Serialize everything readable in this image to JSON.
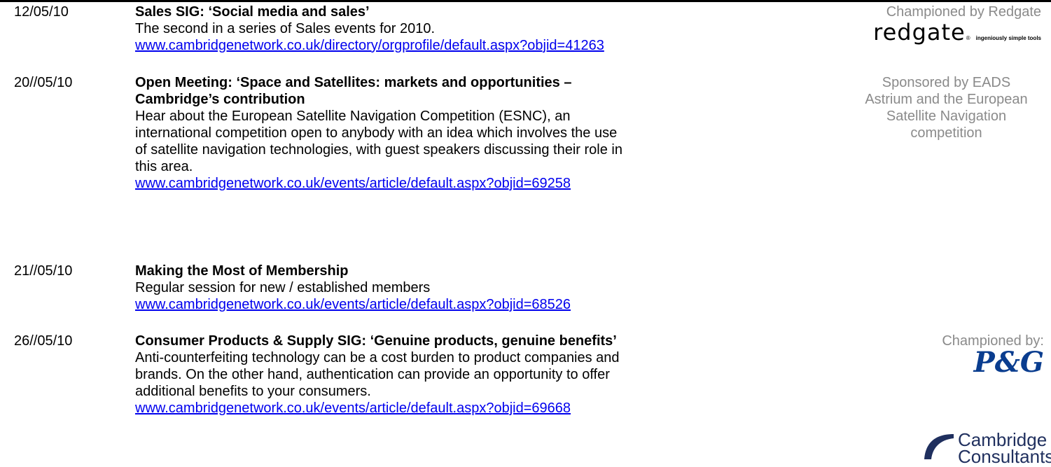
{
  "events": [
    {
      "date": "12/05/10",
      "title": "Sales SIG: ‘Social media and sales’",
      "description": "The second in a series of Sales events for 2010.",
      "link": "www.cambridgenetwork.co.uk/directory/orgprofile/default.aspx?objid=41263",
      "sponsor": "Championed by Redgate",
      "logo_text": "redgate",
      "logo_tagline": "ingeniously simple tools"
    },
    {
      "date": "20//05/10",
      "title_line1": "Open Meeting: ‘Space and Satellites: markets and opportunities –",
      "title_line2": "Cambridge’s contribution",
      "description_lines": [
        "Hear about the European Satellite Navigation Competition (ESNC), an",
        "international competition open to anybody with an idea which involves the use",
        "of satellite navigation technologies, with guest speakers discussing their role in",
        "this area."
      ],
      "link": "www.cambridgenetwork.co.uk/events/article/default.aspx?objid=69258",
      "sponsor_lines": [
        "Sponsored by EADS",
        "Astrium and the European",
        "Satellite Navigation",
        "competition"
      ]
    },
    {
      "date": "21//05/10",
      "title": "Making the Most of Membership",
      "description": "Regular session for new / established members",
      "link": "www.cambridgenetwork.co.uk/events/article/default.aspx?objid=68526"
    },
    {
      "date": "26//05/10",
      "title": "Consumer Products & Supply SIG: ‘Genuine products, genuine benefits’",
      "description_lines": [
        "Anti-counterfeiting technology can be a cost burden to product companies and",
        "brands. On the other hand, authentication can provide an opportunity to offer",
        "additional benefits to your consumers."
      ],
      "link": "www.cambridgenetwork.co.uk/events/article/default.aspx?objid=69668",
      "sponsor": "Championed by:",
      "logo_pg": "P&G",
      "logo_cc_line1": "Cambridge",
      "logo_cc_line2": "Consultants"
    }
  ],
  "colors": {
    "link": "#0000ee",
    "sponsor_text": "#8a8a8a",
    "pg_blue": "#0a3d8f",
    "cc_navy": "#1f2f5e"
  }
}
